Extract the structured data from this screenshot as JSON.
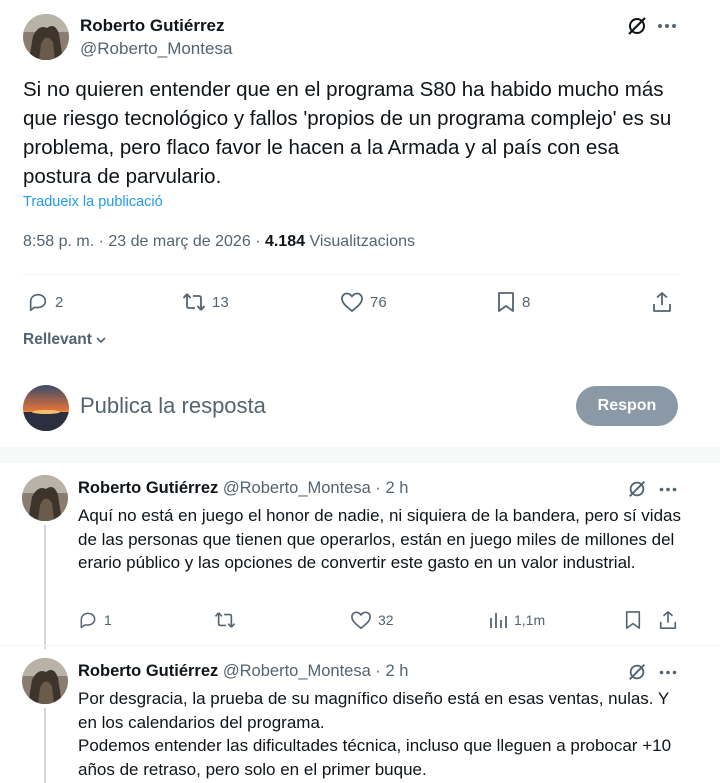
{
  "main": {
    "author_name": "Roberto Gutiérrez",
    "author_handle": "@Roberto_Montesa",
    "text": "Si no quieren entender que en el programa S80 ha habido mucho más que riesgo tecnológico y fallos 'propios de un programa complejo' es su problema, pero flaco favor le hacen a la Armada y al país con esa postura de parvulario.",
    "translate_label": "Tradueix la publicació",
    "time": "8:58 p. m.",
    "separator": "·",
    "date": "23 de març de 2026",
    "views_count": "4.184",
    "views_label": "Visualitzacions",
    "replies": "2",
    "reposts": "13",
    "likes": "76",
    "bookmarks": "8"
  },
  "sort": {
    "label": "Rellevant"
  },
  "compose": {
    "placeholder": "Publica la resposta",
    "button_label": "Respon"
  },
  "replies": [
    {
      "author_name": "Roberto Gutiérrez",
      "author_handle": "@Roberto_Montesa · 2 h",
      "text": "Aquí no está en juego el honor de nadie, ni siquiera de la bandera, pero sí vidas de las personas que tienen que operarlos, están en juego miles de millones del erario público y las opciones de convertir este gasto en un valor industrial.",
      "replies": "1",
      "reposts": "",
      "likes": "32",
      "views": "1,1m"
    },
    {
      "author_name": "Roberto Gutiérrez",
      "author_handle": "@Roberto_Montesa · 2 h",
      "text": "Por desgracia, la prueba de su magnífico diseño está en esas ventas, nulas. Y en los calendarios del programa.\nPodemos entender las dificultades técnica, incluso que lleguen a probocar +10 años de retraso, pero solo en el primer buque."
    }
  ],
  "colors": {
    "accent": "#1d9bf0",
    "muted": "#536471",
    "text": "#0f1419",
    "button_disabled": "#8b98a5"
  }
}
